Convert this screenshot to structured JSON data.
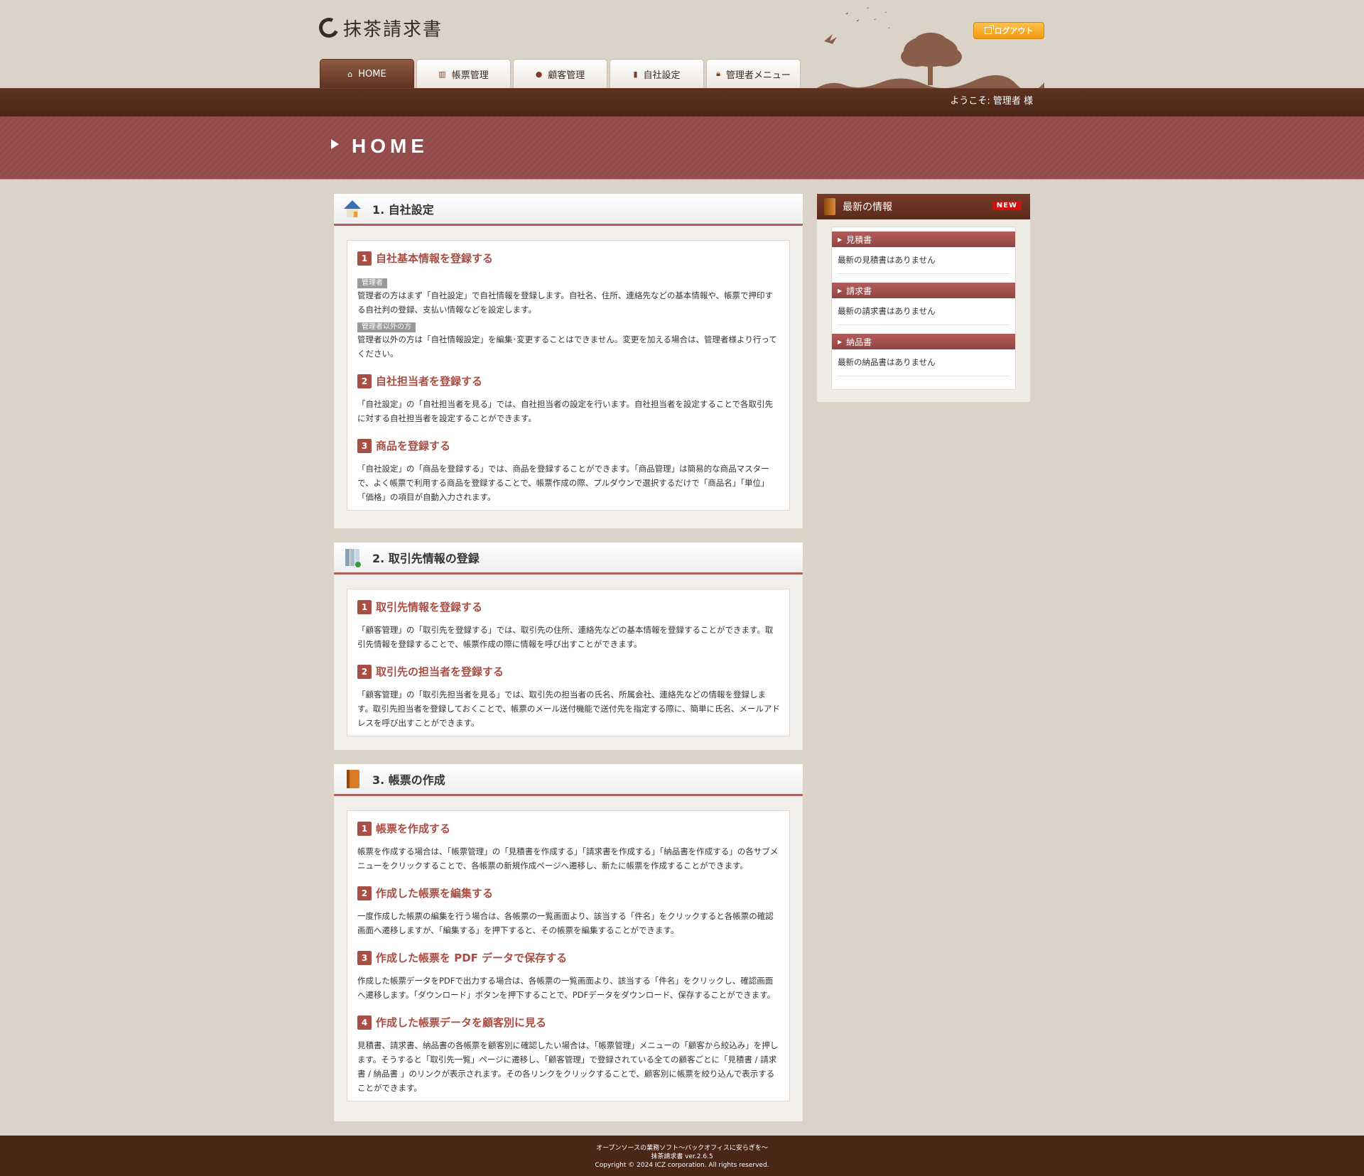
{
  "header": {
    "logo_text": "抹茶請求書",
    "logout_label": "ログアウト",
    "welcome_text": "ようこそ: 管理者 様"
  },
  "tabs": [
    {
      "label": "HOME",
      "icon": "home-icon"
    },
    {
      "label": "帳票管理",
      "icon": "book-icon"
    },
    {
      "label": "顧客管理",
      "icon": "person-icon"
    },
    {
      "label": "自社設定",
      "icon": "building-icon"
    },
    {
      "label": "管理者メニュー",
      "icon": "lock-icon"
    }
  ],
  "page_title": "HOME",
  "sections": [
    {
      "title": "1. 自社設定",
      "icon": "house-icon",
      "items": [
        {
          "num": "1",
          "title": "自社基本情報を登録する",
          "tag1": "管理者",
          "text1": "管理者の方はまず「自社設定」で自社情報を登録します。自社名、住所、連絡先などの基本情報や、帳票で押印する自社判の登録、支払い情報などを設定します。",
          "tag2": "管理者以外の方",
          "text2": "管理者以外の方は「自社情報設定」を編集･変更することはできません。変更を加える場合は、管理者様より行ってください。"
        },
        {
          "num": "2",
          "title": "自社担当者を登録する",
          "text": "「自社設定」の「自社担当者を見る」では、自社担当者の設定を行います。自社担当者を設定することで各取引先に対する自社担当者を設定することができます。"
        },
        {
          "num": "3",
          "title": "商品を登録する",
          "text": "「自社設定」の「商品を登録する」では、商品を登録することができます。「商品管理」は簡易的な商品マスターで、よく帳票で利用する商品を登録することで、帳票作成の際、プルダウンで選択するだけで「商品名」「単位」「価格」の項目が自動入力されます。"
        }
      ]
    },
    {
      "title": "2. 取引先情報の登録",
      "icon": "binder-icon",
      "items": [
        {
          "num": "1",
          "title": "取引先情報を登録する",
          "text": "「顧客管理」の「取引先を登録する」では、取引先の住所、連絡先などの基本情報を登録することができます。取引先情報を登録することで、帳票作成の際に情報を呼び出すことができます。"
        },
        {
          "num": "2",
          "title": "取引先の担当者を登録する",
          "text": "「顧客管理」の「取引先担当者を見る」では、取引先の担当者の氏名、所属会社、連絡先などの情報を登録します。取引先担当者を登録しておくことで、帳票のメール送付機能で送付先を指定する際に、簡単に氏名、メールアドレスを呼び出すことができます。"
        }
      ]
    },
    {
      "title": "3. 帳票の作成",
      "icon": "book-orange-icon",
      "items": [
        {
          "num": "1",
          "title": "帳票を作成する",
          "text": "帳票を作成する場合は、「帳票管理」の「見積書を作成する」「請求書を作成する」「納品書を作成する」の各サブメニューをクリックすることで、各帳票の新規作成ページへ遷移し、新たに帳票を作成することができます。"
        },
        {
          "num": "2",
          "title": "作成した帳票を編集する",
          "text": "一度作成した帳票の編集を行う場合は、各帳票の一覧画面より、該当する「件名」をクリックすると各帳票の確認画面へ遷移しますが、「編集する」を押下すると、その帳票を編集することができます。"
        },
        {
          "num": "3",
          "title": "作成した帳票を PDF データで保存する",
          "text": "作成した帳票データをPDFで出力する場合は、各帳票の一覧画面より、該当する「件名」をクリックし、確認画面へ遷移します。「ダウンロード」ボタンを押下することで、PDFデータをダウンロード、保存することができます。"
        },
        {
          "num": "4",
          "title": "作成した帳票データを顧客別に見る",
          "text": "見積書、請求書、納品書の各帳票を顧客別に確認したい場合は、「帳票管理」メニューの「顧客から絞込み」を押します。そうすると「取引先一覧」ページに遷移し、「顧客管理」で登録されている全ての顧客ごとに「見積書 / 請求書 / 納品書 」のリンクが表示されます。その各リンクをクリックすることで、顧客別に帳票を絞り込んで表示することができます。"
        }
      ]
    }
  ],
  "sidebar": {
    "title": "最新の情報",
    "badge": "NEW",
    "groups": [
      {
        "title": "見積書",
        "text": "最新の見積書はありません"
      },
      {
        "title": "請求書",
        "text": "最新の請求書はありません"
      },
      {
        "title": "納品書",
        "text": "最新の納品書はありません"
      }
    ]
  },
  "footer": {
    "line1": "オープンソースの業務ソフト～バックオフィスに安らぎを～",
    "line2": "抹茶請求書 ver.2.6.5",
    "line3": "Copyright © 2024 ICZ corporation. All rights reserved."
  }
}
